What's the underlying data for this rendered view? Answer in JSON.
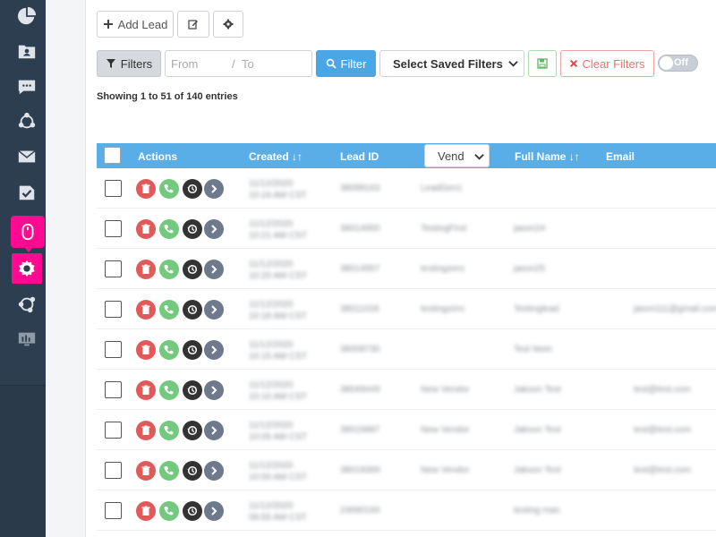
{
  "sidebar": {
    "icons": [
      {
        "name": "dashboard-icon"
      },
      {
        "name": "contacts-folder-icon"
      },
      {
        "name": "chat-icon"
      },
      {
        "name": "network-icon"
      },
      {
        "name": "mail-icon"
      },
      {
        "name": "task-check-icon"
      },
      {
        "name": "mouse-icon",
        "active": true
      },
      {
        "name": "gear-icon"
      },
      {
        "name": "integrations-icon"
      },
      {
        "name": "monitor-icon"
      }
    ]
  },
  "toolbar": {
    "add_lead_label": "Add Lead",
    "filters_label": "Filters",
    "from_placeholder": "From",
    "separator": "/",
    "to_placeholder": "To",
    "filter_button_label": "Filter",
    "saved_filters_label": "Select Saved Filters",
    "clear_filters_label": "Clear Filters",
    "toggle_label": "Off"
  },
  "table": {
    "entries_text": "Showing 1 to 51 of 140 entries",
    "headers": {
      "actions": "Actions",
      "created": "Created",
      "lead_id": "Lead ID",
      "vendor": "Vend",
      "full_name": "Full Name",
      "email": "Email"
    },
    "rows": [
      {
        "created": "11/12/2020",
        "created2": "10:24 AM CST",
        "lead_id": "38098163",
        "vendor": "LeadGen1",
        "name": "",
        "email": ""
      },
      {
        "created": "11/12/2020",
        "created2": "10:21 AM CST",
        "lead_id": "38014950",
        "vendor": "TestingFirst",
        "name": "jason24",
        "email": ""
      },
      {
        "created": "11/12/2020",
        "created2": "10:20 AM CST",
        "lead_id": "38014957",
        "vendor": "testingzero",
        "name": "jason25",
        "email": ""
      },
      {
        "created": "11/12/2020",
        "created2": "10:18 AM CST",
        "lead_id": "38011026",
        "vendor": "testingzero",
        "name": "Testinglead",
        "email": "jason111@gmail.com"
      },
      {
        "created": "11/12/2020",
        "created2": "10:15 AM CST",
        "lead_id": "38008730",
        "vendor": "",
        "name": "Test Neet",
        "email": ""
      },
      {
        "created": "11/12/2020",
        "created2": "10:10 AM CST",
        "lead_id": "38049449",
        "vendor": "New Vendor",
        "name": "Jakson Test",
        "email": "test@test.com"
      },
      {
        "created": "11/12/2020",
        "created2": "10:05 AM CST",
        "lead_id": "38016887",
        "vendor": "New Vendor",
        "name": "Jakson Test",
        "email": "test@test.com"
      },
      {
        "created": "11/12/2020",
        "created2": "10:00 AM CST",
        "lead_id": "38019369",
        "vendor": "New Vendor",
        "name": "Jakson Test",
        "email": "test@test.com"
      },
      {
        "created": "11/12/2020",
        "created2": "09:55 AM CST",
        "lead_id": "23680193",
        "vendor": "",
        "name": "testing man",
        "email": ""
      }
    ]
  }
}
